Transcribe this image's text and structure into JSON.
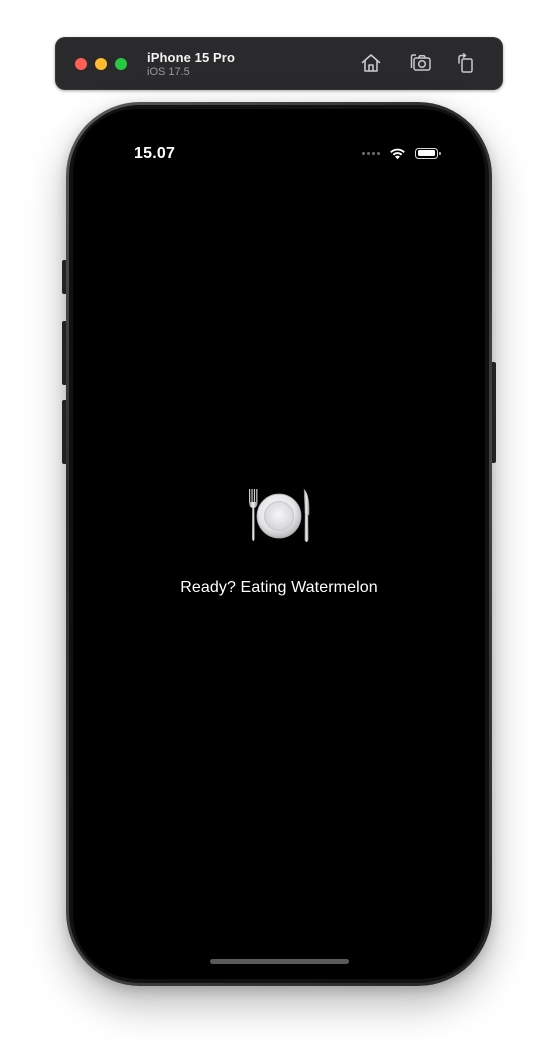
{
  "simulator": {
    "device_name": "iPhone 15 Pro",
    "os_version": "iOS 17.5",
    "buttons": {
      "home_icon": "home-icon",
      "screenshot_icon": "camera-icon",
      "rotate_icon": "rotate-icon"
    },
    "window_controls": {
      "close_color": "#ff5f57",
      "minimize_color": "#febc2e",
      "zoom_color": "#28c840"
    }
  },
  "status_bar": {
    "time": "15.07",
    "battery_level": 1.0
  },
  "content": {
    "icon": "fork-knife-plate-icon",
    "message": "Ready? Eating Watermelon"
  }
}
